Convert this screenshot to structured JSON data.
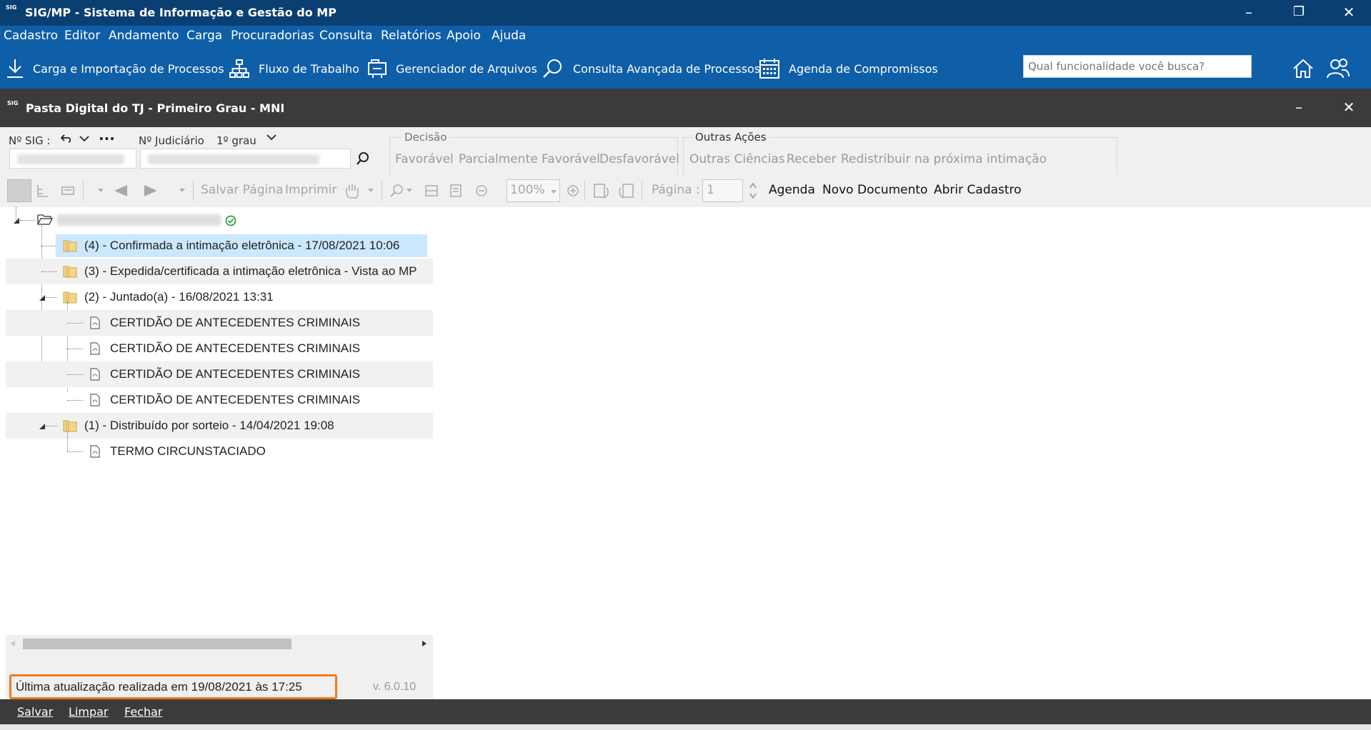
{
  "app": {
    "title": "SIG/MP - Sistema de Informação e Gestão do MP",
    "logo_text": "SIG"
  },
  "window_controls": {
    "minimize": "–",
    "maximize": "❐",
    "close": "✕"
  },
  "menu": [
    "Cadastro",
    "Editor",
    "Andamento",
    "Carga",
    "Procuradorias",
    "Consulta",
    "Relatórios",
    "Apoio",
    "Ajuda"
  ],
  "toolbar": {
    "items": [
      "Carga e Importação de Processos",
      "Fluxo de Trabalho",
      "Gerenciador de Arquivos",
      "Consulta Avançada de Processos",
      "Agenda de Compromissos"
    ],
    "search_placeholder": "Qual funcionalidade você busca?"
  },
  "child_window": {
    "title": "Pasta Digital do TJ - Primeiro Grau - MNI",
    "minimize": "–",
    "close": "✕"
  },
  "form": {
    "sig_label": "Nº SIG :",
    "more": "···",
    "judiciario_label": "Nº Judiciário",
    "grau": "1º grau"
  },
  "decisao": {
    "title": "Decisão",
    "buttons": [
      "Favorável",
      "Parcialmente Favorável",
      "Desfavorável"
    ]
  },
  "outras_acoes": {
    "title": "Outras Ações",
    "buttons": [
      "Outras Ciências",
      "Receber",
      "Redistribuir na próxima intimação"
    ]
  },
  "viewer_toolbar": {
    "salvar_pagina": "Salvar Página",
    "imprimir": "Imprimir",
    "zoom": "100%",
    "pagina_label": "Página :",
    "pagina_value": "1",
    "agenda": "Agenda",
    "novo_documento": "Novo Documento",
    "abrir_cadastro": "Abrir Cadastro"
  },
  "tree": {
    "items": [
      "(4) - Confirmada a intimação eletrônica - 17/08/2021 10:06",
      "(3) - Expedida/certificada a intimação eletrônica - Vista ao MP",
      "(2) - Juntado(a) - 16/08/2021 13:31",
      "CERTIDÃO DE ANTECEDENTES CRIMINAIS",
      "CERTIDÃO DE ANTECEDENTES CRIMINAIS",
      "CERTIDÃO DE ANTECEDENTES CRIMINAIS",
      "CERTIDÃO DE ANTECEDENTES CRIMINAIS",
      "(1) - Distribuído por sorteio - 14/04/2021 19:08",
      "TERMO CIRCUNSTACIADO"
    ]
  },
  "status": {
    "last_update": "Última atualização realizada em 19/08/2021 às 17:25",
    "version": "v. 6.0.10"
  },
  "bottom": {
    "salvar": "Salvar",
    "limpar": "Limpar",
    "fechar": "Fechar"
  },
  "colors": {
    "title_bar": "#0a3f72",
    "menu_bar": "#0f5ea8",
    "child_bar": "#3b3b3b",
    "highlight": "#cce8ff",
    "status_border": "#f07c1b"
  }
}
